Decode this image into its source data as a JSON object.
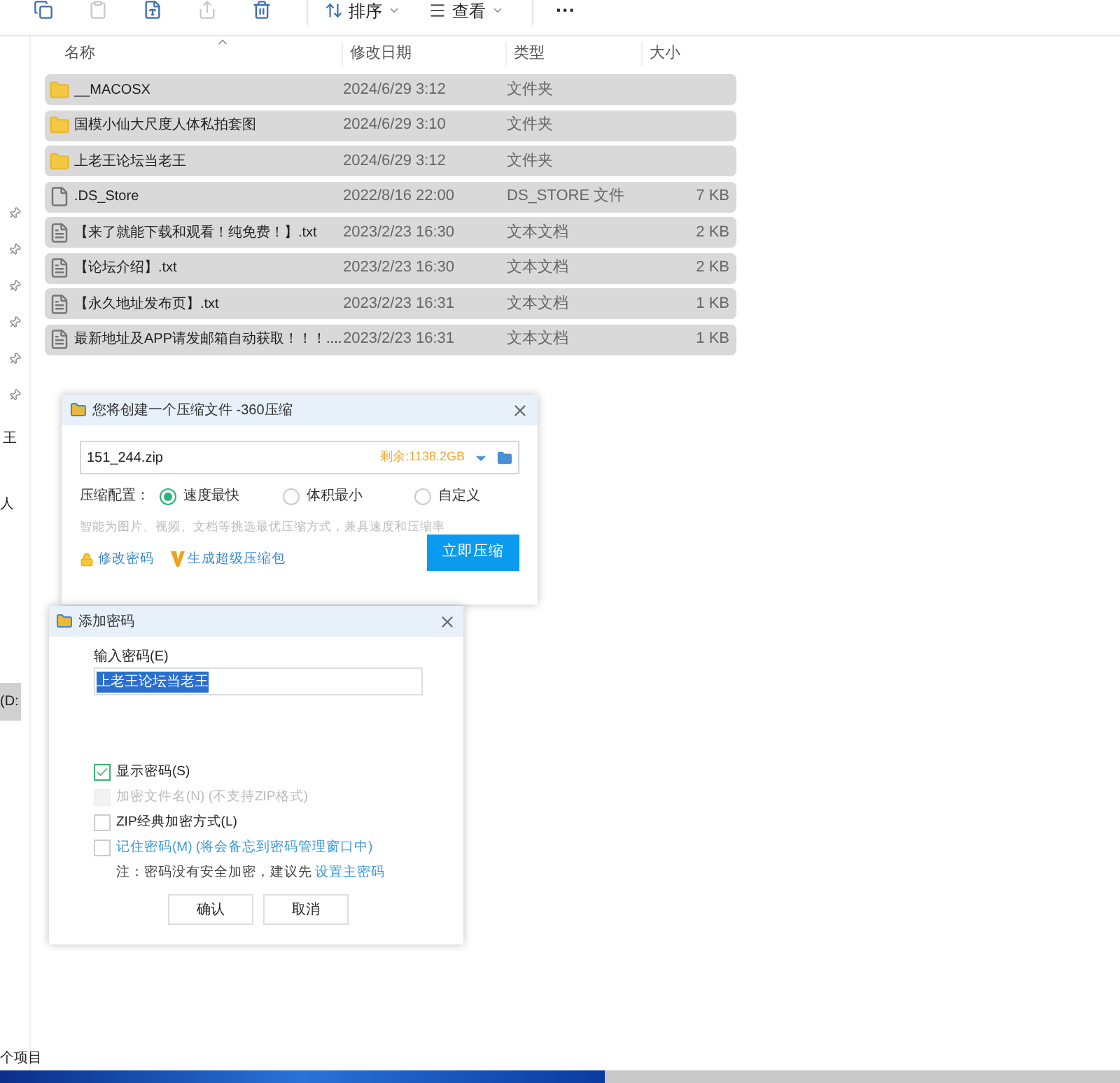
{
  "toolbar": {
    "icons": [
      {
        "kind": "copy",
        "disabled": false
      },
      {
        "kind": "paste",
        "disabled": true
      },
      {
        "kind": "rename",
        "disabled": false
      },
      {
        "kind": "share",
        "disabled": true
      },
      {
        "kind": "delete",
        "disabled": false
      }
    ],
    "sort": "排序",
    "view": "查看",
    "more": "···"
  },
  "columns": [
    "名称",
    "修改日期",
    "类型",
    "大小"
  ],
  "files": [
    {
      "kind": "folder",
      "name": "__MACOSX",
      "date": "2024/6/29 3:12",
      "type": "文件夹",
      "selected": true
    },
    {
      "kind": "folder",
      "name": "国模小仙大尺度人体私拍套图",
      "date": "2024/6/29 3:10",
      "type": "文件夹",
      "selected": true
    },
    {
      "kind": "folder",
      "name": "上老王论坛当老王",
      "date": "2024/6/29 3:12",
      "type": "文件夹",
      "selected": true
    },
    {
      "kind": "file",
      "name": ".DS_Store",
      "date": "2022/8/16 22:00",
      "type": "DS_STORE 文件",
      "size": "7 KB",
      "selected": true
    },
    {
      "kind": "text",
      "name": "【来了就能下载和观看！纯免费！】.txt",
      "date": "2023/2/23 16:30",
      "type": "文本文档",
      "size": "2 KB",
      "selected": true
    },
    {
      "kind": "text",
      "name": "【论坛介绍】.txt",
      "date": "2023/2/23 16:30",
      "type": "文本文档",
      "size": "2 KB",
      "selected": true
    },
    {
      "kind": "text",
      "name": "【永久地址发布页】.txt",
      "date": "2023/2/23 16:31",
      "type": "文本文档",
      "size": "1 KB",
      "selected": true
    },
    {
      "kind": "text",
      "name": "最新地址及APP请发邮箱自动获取！！！....",
      "date": "2023/2/23 16:31",
      "type": "文本文档",
      "size": "1 KB",
      "selected": true
    }
  ],
  "sidebar": {
    "items": [
      {
        "label": "王",
        "selected": false
      },
      {
        "label": "人",
        "selected": false
      },
      {
        "label": "(D:",
        "selected": true
      }
    ]
  },
  "status_bar": "个项目",
  "compress_dialog": {
    "title": "您将创建一个压缩文件 -360压缩",
    "filename": "151_244.zip",
    "free_space": "剩余:1138.2GB",
    "config_label": "压缩配置：",
    "options": [
      {
        "label": "速度最快",
        "selected": true
      },
      {
        "label": "体积最小",
        "selected": false
      },
      {
        "label": "自定义",
        "selected": false
      }
    ],
    "hint": "智能为图片、视频、文档等挑选最优压缩方式，兼具速度和压缩率",
    "links": [
      "修改密码",
      "生成超级压缩包"
    ],
    "button": "立即压缩"
  },
  "password_dialog": {
    "title": "添加密码",
    "field_label": "输入密码(E)",
    "value": "上老王论坛当老王",
    "checks": [
      {
        "label": "显示密码(S)",
        "checked": true,
        "disabled": false,
        "link": false
      },
      {
        "label": "加密文件名(N) (不支持ZIP格式)",
        "checked": false,
        "disabled": true,
        "link": false
      },
      {
        "label": "ZIP经典加密方式(L)",
        "checked": false,
        "disabled": false,
        "link": false
      },
      {
        "label": "记住密码(M) (将会备忘到密码管理窗口中)",
        "checked": false,
        "disabled": false,
        "link": true
      }
    ],
    "note": "注：密码没有安全加密，建议先",
    "note_link": "设置主密码",
    "buttons": [
      "确认",
      "取消"
    ]
  }
}
